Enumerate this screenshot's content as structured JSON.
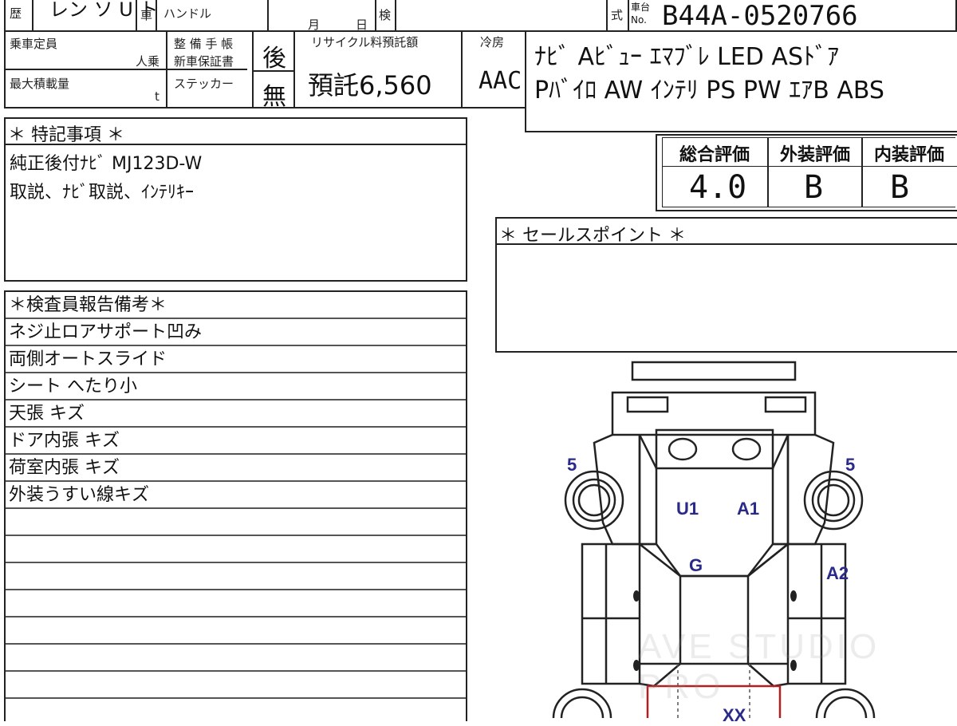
{
  "header": {
    "label_history": "歴",
    "model_partial": "レン ソ U ト",
    "label_car": "車",
    "label_handle": "ハンドル",
    "label_month": "月",
    "label_day": "日",
    "label_inspection": "検",
    "label_type": "式",
    "label_chassis_top": "車台",
    "label_chassis_no": "No.",
    "chassis_number": "B44A-0520766"
  },
  "specs": {
    "label_capacity": "乗車定員",
    "unit_capacity": "人乗",
    "label_maint_1": "整 備 手 帳",
    "label_maint_2": "新車保証書",
    "maint_mark": "後",
    "label_recycle": "リサイクル料預託額",
    "recycle_value": "預託6,560",
    "label_aircon": "冷房",
    "aircon_value": "AAC",
    "label_max_load": "最大積載量",
    "unit_load": "t",
    "label_sticker": "ステッカー",
    "sticker_mark": "無"
  },
  "equipment": {
    "line1": "ﾅﾋﾞ Aﾋﾞｭｰ ｴﾏﾌﾞﾚ LED ASﾄﾞｱ",
    "line2": "Pﾊﾞｲﾛ AW ｲﾝﾃﾘ PS PW ｴｱB ABS"
  },
  "special_notes": {
    "title": "＊ 特記事項 ＊",
    "line1": "純正後付ﾅﾋﾞ MJ123D-W",
    "line2": "取説、ﾅﾋﾞ取説、ｲﾝﾃﾘｷｰ"
  },
  "grades": {
    "overall_label": "総合評価",
    "overall_value": "4.0",
    "exterior_label": "外装評価",
    "exterior_value": "B",
    "interior_label": "内装評価",
    "interior_value": "B"
  },
  "sales_points": {
    "title": "＊ セールスポイント ＊"
  },
  "inspector_report": {
    "title": "＊検査員報告備考＊",
    "items": [
      "ネジ止ロアサポート凹み",
      "両側オートスライド",
      "シート へたり小",
      "天張 キズ",
      "ドア内張 キズ",
      "荷室内張 キズ",
      "外装うすい線キズ"
    ]
  },
  "diagram": {
    "labels": {
      "tire_front_left": "5",
      "tire_front_right": "5",
      "bonnet_left": "U1",
      "bonnet_right": "A1",
      "windshield": "G",
      "right_fender": "A2",
      "rear_bottom": "XX"
    }
  },
  "watermark": "AVE STUDIO PRO"
}
